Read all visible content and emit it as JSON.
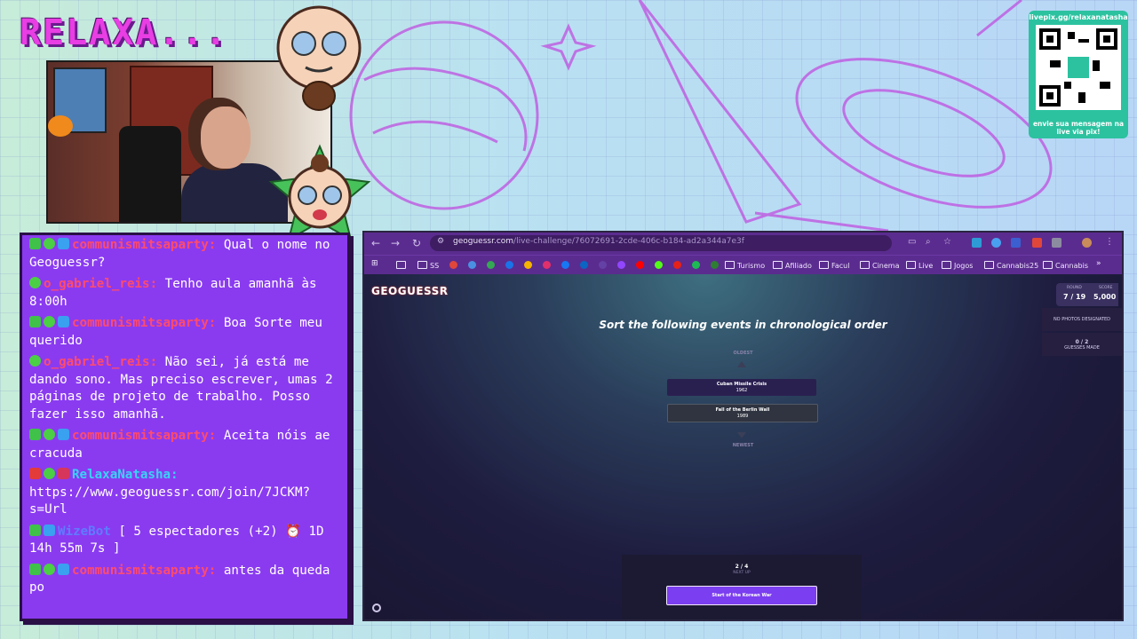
{
  "overlay": {
    "title": "RELAXA...",
    "qr_top": "livepix.gg/relaxanatasha",
    "qr_bottom": "envie sua mensagem na live via pix!"
  },
  "chat": {
    "messages": [
      {
        "badges": [
          "b-green",
          "b-alien",
          "b-blue"
        ],
        "user": "communismitsaparty:",
        "user_class": "u-comm",
        "text": " Qual o nome no Geoguessr?"
      },
      {
        "badges": [
          "b-alien"
        ],
        "user": "o_gabriel_reis:",
        "user_class": "u-gab",
        "text": " Tenho aula amanhã às 8:00h"
      },
      {
        "badges": [
          "b-green",
          "b-alien",
          "b-blue"
        ],
        "user": "communismitsaparty:",
        "user_class": "u-comm",
        "text": " Boa Sorte meu querido"
      },
      {
        "badges": [
          "b-alien"
        ],
        "user": "o_gabriel_reis:",
        "user_class": "u-gab",
        "text": " Não sei, já está me dando sono. Mas preciso escrever, umas 2 páginas de projeto de trabalho. Posso fazer isso amanhã."
      },
      {
        "badges": [
          "b-green",
          "b-alien",
          "b-blue"
        ],
        "user": "communismitsaparty:",
        "user_class": "u-comm",
        "text": " Aceita nóis ae cracuda"
      },
      {
        "badges": [
          "b-red",
          "b-alien",
          "b-gift"
        ],
        "user": "RelaxaNatasha:",
        "user_class": "u-host",
        "text": " https://www.geoguessr.com/join/7JCKM?s=Url"
      },
      {
        "badges": [
          "b-green",
          "b-blue"
        ],
        "user": "WizeBot",
        "user_class": "u-bot",
        "text": " [ 5 espectadores (+2) ⏰ 1D 14h 55m 7s ]"
      },
      {
        "badges": [
          "b-green",
          "b-alien",
          "b-blue"
        ],
        "user": "communismitsaparty:",
        "user_class": "u-comm",
        "text": " antes da queda po"
      }
    ]
  },
  "browser": {
    "url_main": "geoguessr.com",
    "url_rest": "/live-challenge/76072691-2cde-406c-b184-ad2a344a7e3f",
    "bookmarks": [
      "SS",
      "Turismo",
      "Afiliado",
      "Facul",
      "Cinema",
      "Live",
      "Jogos",
      "Cannabis25",
      "Cannabis"
    ]
  },
  "game": {
    "logo": "GEOGUESSR",
    "round_label": "ROUND",
    "round_value": "7 / 19",
    "score_label": "SCORE",
    "score_value": "5,000",
    "side_text_1": "NO PHOTOS DESIGNATED",
    "side_count": "0 / 2",
    "side_text_2": "GUESSES MADE",
    "question": "Sort the following events in chronological order",
    "oldest_label": "OLDEST",
    "newest_label": "NEWEST",
    "cards": [
      {
        "title": "Cuban Missile Crisis",
        "year": "1962"
      },
      {
        "title": "Fall of the Berlin Wall",
        "year": "1989"
      }
    ],
    "progress": "2 / 4",
    "next_label": "NEXT UP",
    "next_card": "Start of the Korean War"
  }
}
